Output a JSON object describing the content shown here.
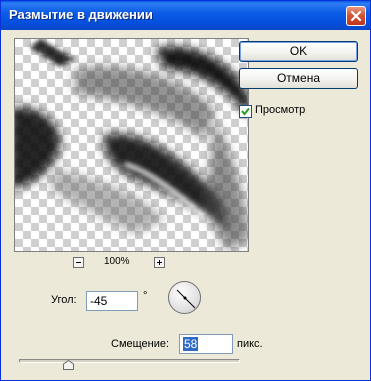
{
  "window": {
    "title": "Размытие в движении"
  },
  "buttons": {
    "ok": "OK",
    "cancel": "Отмена"
  },
  "preview_checkbox": {
    "label": "Просмотр",
    "checked": true
  },
  "zoom": {
    "level": "100%"
  },
  "angle": {
    "label": "Угол:",
    "value": "-45",
    "unit": "°"
  },
  "distance": {
    "label": "Смещение:",
    "value": "58",
    "unit": "пикс."
  },
  "icons": [
    "close-icon",
    "zoom-out-icon",
    "zoom-in-icon",
    "checkmark-icon",
    "angle-dial-icon",
    "slider-thumb-icon"
  ],
  "colors": {
    "titlebar": "#0552e0",
    "dialog_bg": "#ece9d8",
    "selection": "#316ac5"
  }
}
